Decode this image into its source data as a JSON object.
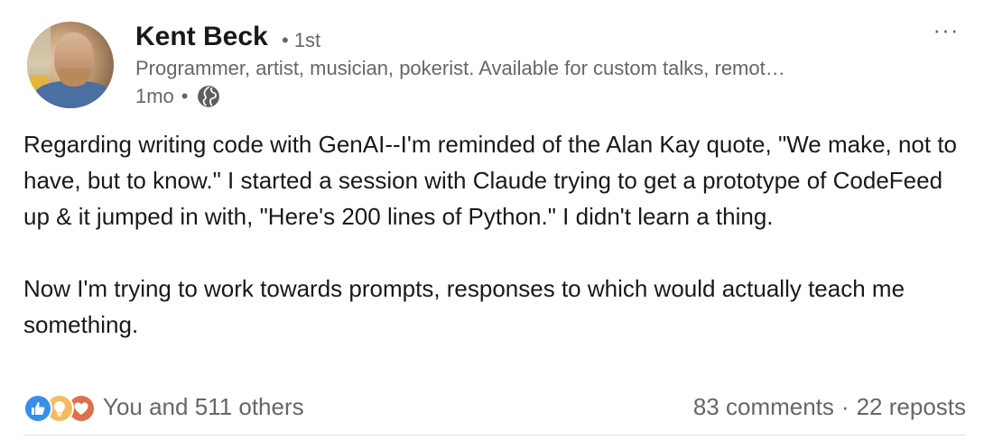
{
  "author": {
    "name": "Kent Beck",
    "degree": "• 1st",
    "headline": "Programmer, artist, musician, pokerist. Available for custom talks, remot…",
    "time_ago": "1mo",
    "meta_separator": "•",
    "visibility_icon": "globe-icon"
  },
  "more_menu": {
    "label": "···",
    "icon": "more-horizontal-icon"
  },
  "post": {
    "paragraphs": [
      "Regarding writing code with GenAI--I'm reminded of the Alan Kay quote, \"We make, not to have, but to know.\" I started a session with Claude trying to get a prototype of CodeFeed up & it jumped in with, \"Here's 200 lines of Python.\" I didn't learn a thing.",
      "Now I'm trying to work towards prompts, responses to which would actually teach me something."
    ]
  },
  "social": {
    "reaction_icons": [
      "like-icon",
      "insightful-icon",
      "love-icon"
    ],
    "reaction_count": "You and 511 others",
    "comments": "83 comments",
    "separator": "·",
    "reposts": "22 reposts"
  },
  "colors": {
    "like": "#378fe9",
    "insightful": "#f5bb5c",
    "love": "#df704d",
    "secondary_text": "#666666",
    "primary_text": "#191919"
  }
}
